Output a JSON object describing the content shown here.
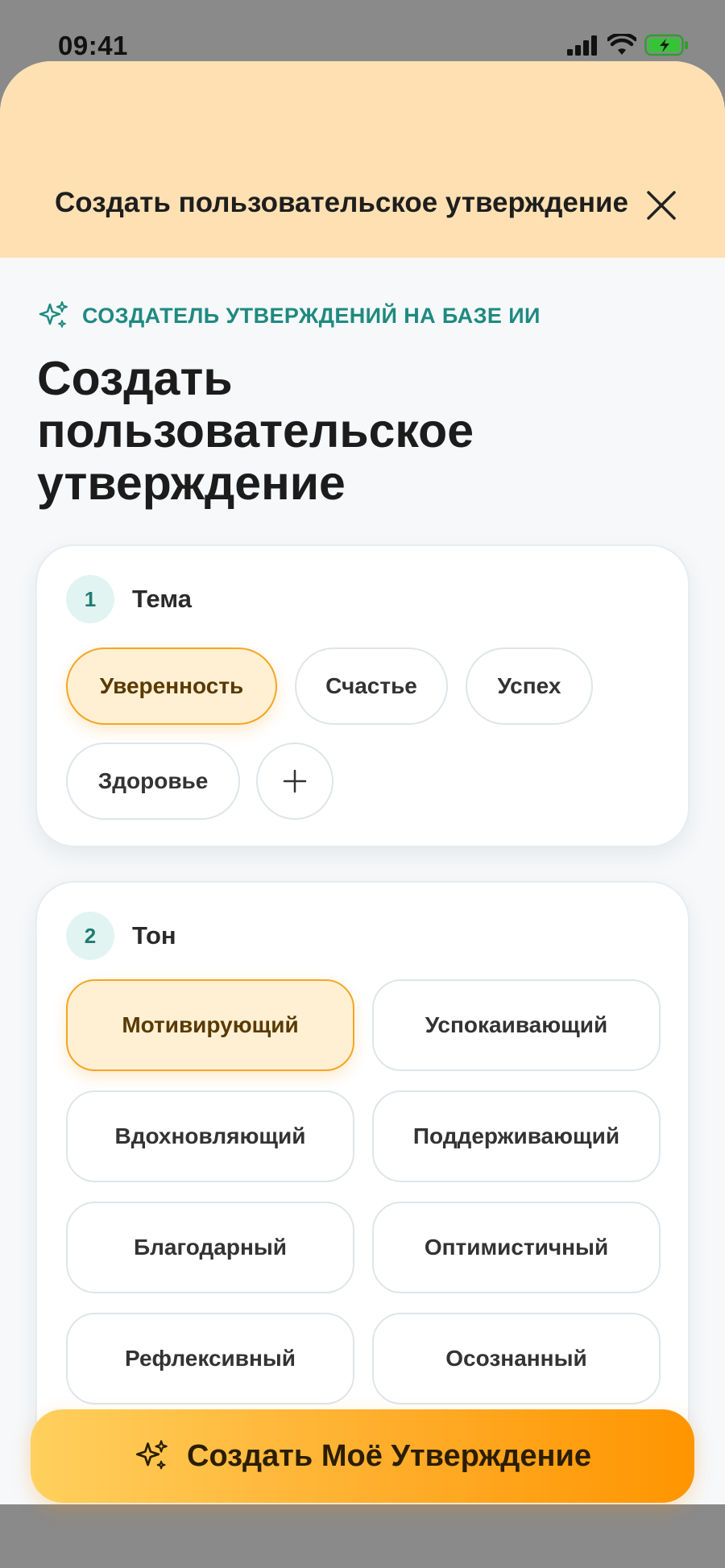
{
  "status_bar": {
    "time": "09:41",
    "icons": [
      "signal-icon",
      "wifi-icon",
      "battery-charging-icon"
    ]
  },
  "header": {
    "title": "Создать пользовательское утверждение",
    "close_icon": "close-icon"
  },
  "eyebrow": {
    "icon": "sparkles-icon",
    "text": "СОЗДАТЕЛЬ УТВЕРЖДЕНИЙ НА БАЗЕ ИИ"
  },
  "page_title": "Создать пользовательское утверждение",
  "theme_section": {
    "step": "1",
    "title": "Тема",
    "options": [
      "Уверенность",
      "Счастье",
      "Успех",
      "Здоровье"
    ],
    "selected": "Уверенность",
    "add_icon": "plus-icon"
  },
  "tone_section": {
    "step": "2",
    "title": "Тон",
    "options": [
      "Мотивирующий",
      "Успокаивающий",
      "Вдохновляющий",
      "Поддерживающий",
      "Благодарный",
      "Оптимистичный",
      "Рефлексивный",
      "Осознанный"
    ],
    "selected": "Мотивирующий"
  },
  "cta": {
    "icon": "sparkles-icon",
    "label": "Создать Моё Утверждение"
  },
  "colors": {
    "header_bg": "#ffe0b3",
    "accent_teal": "#1f8a80",
    "selected_bg": "#fff0d4",
    "selected_border": "#f5a623",
    "cta_start": "#ffd05e",
    "cta_end": "#ff9500"
  }
}
